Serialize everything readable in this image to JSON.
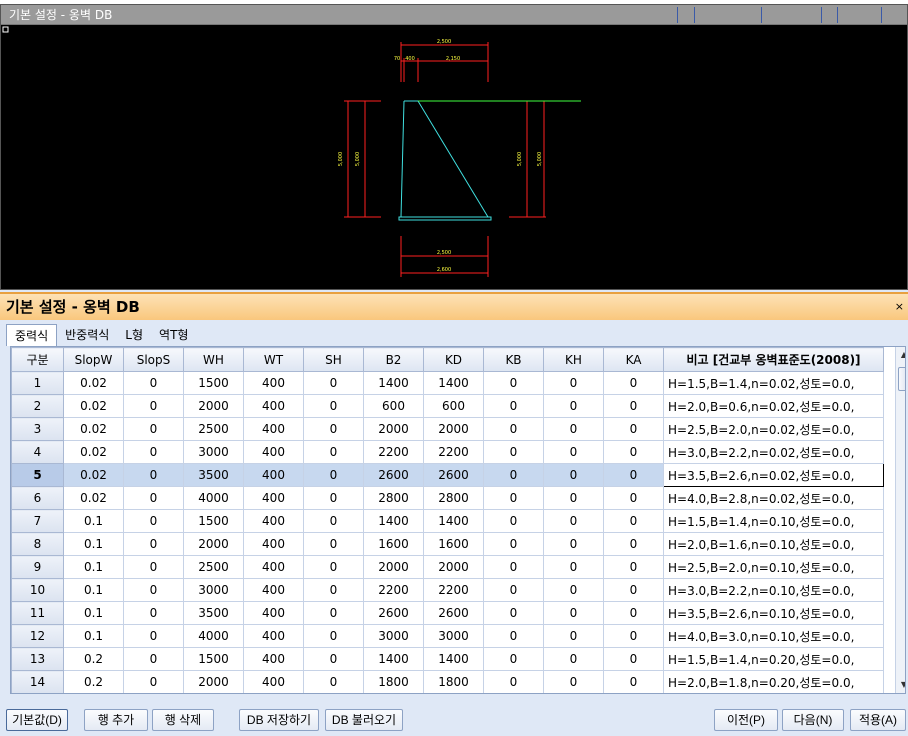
{
  "cad": {
    "title": "기본 설정 - 옹벽  DB",
    "dims": {
      "top_total": "2,500",
      "top_a": "70",
      "top_b": "400",
      "top_c": "2,150",
      "left_h1": "5,000",
      "left_h2": "5,000",
      "right_h1": "5,000",
      "right_h2": "5,000",
      "bottom_1": "2,500",
      "bottom_2": "2,600"
    }
  },
  "panel": {
    "title": "기본 설정 - 옹벽  DB",
    "pin": "ᅟ ×"
  },
  "tabs": [
    "중력식",
    "반중력식",
    "L형",
    "역T형"
  ],
  "grid": {
    "columns": [
      "구분",
      "SlopW",
      "SlopS",
      "WH",
      "WT",
      "SH",
      "B2",
      "KD",
      "KB",
      "KH",
      "KA",
      "비고 [건교부 옹벽표준도(2008)]"
    ],
    "rows": [
      [
        "1",
        "0.02",
        "0",
        "1500",
        "400",
        "0",
        "1400",
        "1400",
        "0",
        "0",
        "0",
        "H=1.5,B=1.4,n=0.02,성토=0.0,"
      ],
      [
        "2",
        "0.02",
        "0",
        "2000",
        "400",
        "0",
        "600",
        "600",
        "0",
        "0",
        "0",
        "H=2.0,B=0.6,n=0.02,성토=0.0,"
      ],
      [
        "3",
        "0.02",
        "0",
        "2500",
        "400",
        "0",
        "2000",
        "2000",
        "0",
        "0",
        "0",
        "H=2.5,B=2.0,n=0.02,성토=0.0,"
      ],
      [
        "4",
        "0.02",
        "0",
        "3000",
        "400",
        "0",
        "2200",
        "2200",
        "0",
        "0",
        "0",
        "H=3.0,B=2.2,n=0.02,성토=0.0,"
      ],
      [
        "5",
        "0.02",
        "0",
        "3500",
        "400",
        "0",
        "2600",
        "2600",
        "0",
        "0",
        "0",
        "H=3.5,B=2.6,n=0.02,성토=0.0,"
      ],
      [
        "6",
        "0.02",
        "0",
        "4000",
        "400",
        "0",
        "2800",
        "2800",
        "0",
        "0",
        "0",
        "H=4.0,B=2.8,n=0.02,성토=0.0,"
      ],
      [
        "7",
        "0.1",
        "0",
        "1500",
        "400",
        "0",
        "1400",
        "1400",
        "0",
        "0",
        "0",
        "H=1.5,B=1.4,n=0.10,성토=0.0,"
      ],
      [
        "8",
        "0.1",
        "0",
        "2000",
        "400",
        "0",
        "1600",
        "1600",
        "0",
        "0",
        "0",
        "H=2.0,B=1.6,n=0.10,성토=0.0,"
      ],
      [
        "9",
        "0.1",
        "0",
        "2500",
        "400",
        "0",
        "2000",
        "2000",
        "0",
        "0",
        "0",
        "H=2.5,B=2.0,n=0.10,성토=0.0,"
      ],
      [
        "10",
        "0.1",
        "0",
        "3000",
        "400",
        "0",
        "2200",
        "2200",
        "0",
        "0",
        "0",
        "H=3.0,B=2.2,n=0.10,성토=0.0,"
      ],
      [
        "11",
        "0.1",
        "0",
        "3500",
        "400",
        "0",
        "2600",
        "2600",
        "0",
        "0",
        "0",
        "H=3.5,B=2.6,n=0.10,성토=0.0,"
      ],
      [
        "12",
        "0.1",
        "0",
        "4000",
        "400",
        "0",
        "3000",
        "3000",
        "0",
        "0",
        "0",
        "H=4.0,B=3.0,n=0.10,성토=0.0,"
      ],
      [
        "13",
        "0.2",
        "0",
        "1500",
        "400",
        "0",
        "1400",
        "1400",
        "0",
        "0",
        "0",
        "H=1.5,B=1.4,n=0.20,성토=0.0,"
      ],
      [
        "14",
        "0.2",
        "0",
        "2000",
        "400",
        "0",
        "1800",
        "1800",
        "0",
        "0",
        "0",
        "H=2.0,B=1.8,n=0.20,성토=0.0,"
      ]
    ],
    "selected_row": 5
  },
  "buttons": {
    "default": "기본값(D)",
    "add_row": "행 추가",
    "delete_row": "행 삭제",
    "db_save": "DB 저장하기",
    "db_load": "DB 불러오기",
    "prev": "이전(P)",
    "next": "다음(N)",
    "apply": "적용(A)"
  },
  "colors": {
    "cad_bg": "#000000",
    "dim_red": "#ff2020",
    "wall_cyan": "#40e0e0",
    "ground_green": "#40ff40",
    "dim_text_yellow": "#ffff40"
  }
}
